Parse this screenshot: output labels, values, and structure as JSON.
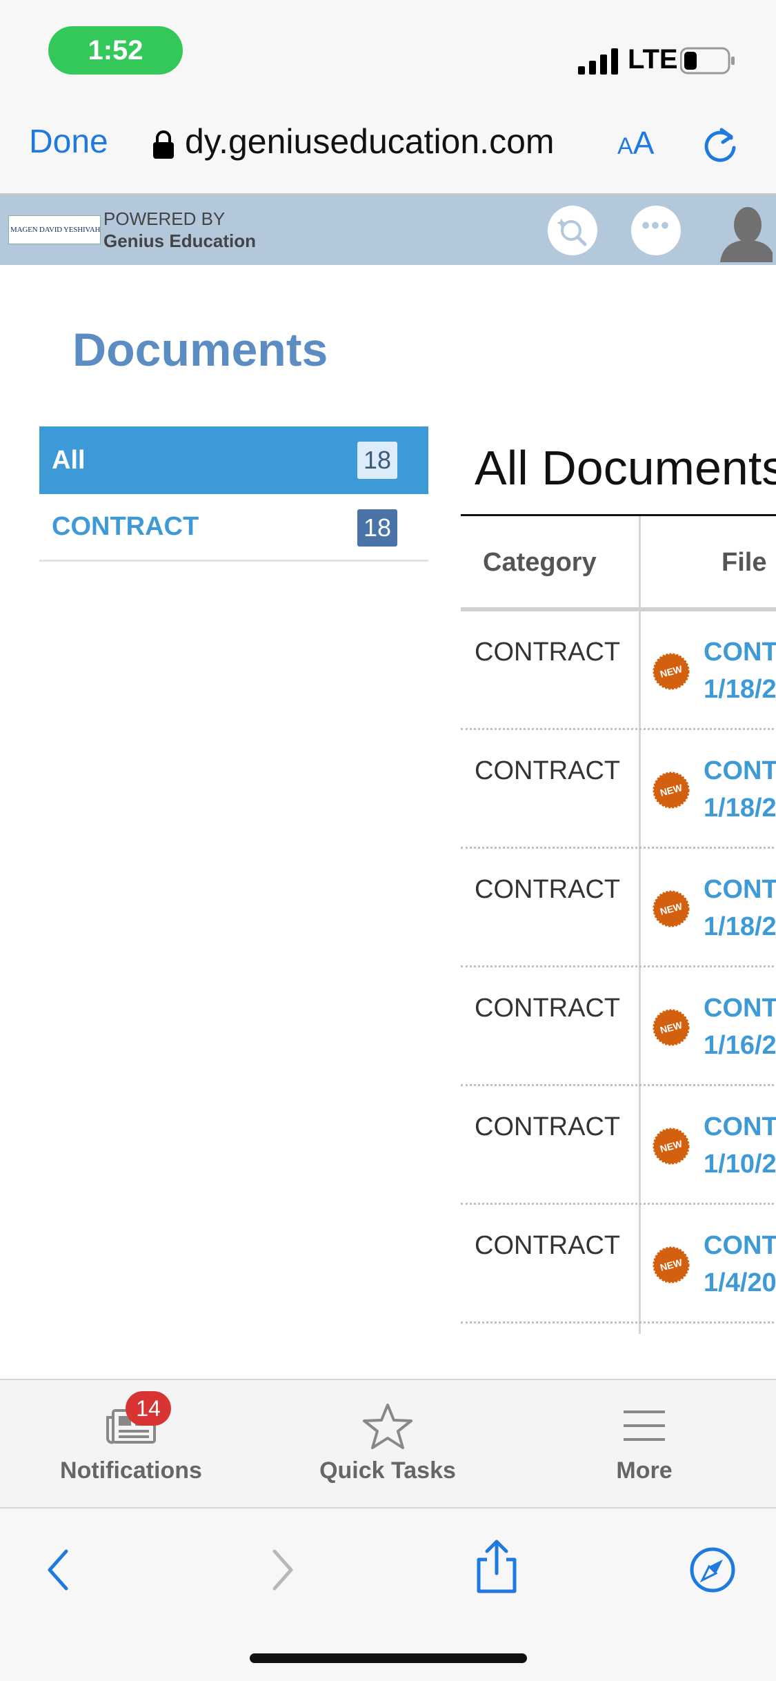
{
  "status_bar": {
    "time": "1:52",
    "network": "LTE"
  },
  "browser": {
    "done_label": "Done",
    "url_text": "dy.geniuseducation.com",
    "text_size_label_small": "A",
    "text_size_label_large": "A"
  },
  "app_header": {
    "school_logo_text": "MAGEN DAVID YESHIVAH",
    "powered_by": "POWERED BY",
    "brand": "Genius Education"
  },
  "page": {
    "title": "Documents"
  },
  "categories": [
    {
      "label": "All",
      "count": "18",
      "active": true
    },
    {
      "label": "CONTRACT",
      "count": "18",
      "active": false
    }
  ],
  "documents": {
    "heading": "All Documents",
    "columns": {
      "category": "Category",
      "file": "File"
    },
    "rows": [
      {
        "category": "CONTRACT",
        "badge": "NEW",
        "file_name": "CONT",
        "file_date": "1/18/2"
      },
      {
        "category": "CONTRACT",
        "badge": "NEW",
        "file_name": "CONT",
        "file_date": "1/18/2"
      },
      {
        "category": "CONTRACT",
        "badge": "NEW",
        "file_name": "CONT",
        "file_date": "1/18/2"
      },
      {
        "category": "CONTRACT",
        "badge": "NEW",
        "file_name": "CONT",
        "file_date": "1/16/2"
      },
      {
        "category": "CONTRACT",
        "badge": "NEW",
        "file_name": "CONT",
        "file_date": "1/10/2"
      },
      {
        "category": "CONTRACT",
        "badge": "NEW",
        "file_name": "CONT",
        "file_date": "1/4/20"
      }
    ]
  },
  "tab_bar": {
    "notifications": {
      "label": "Notifications",
      "badge": "14"
    },
    "quick_tasks": {
      "label": "Quick Tasks"
    },
    "more": {
      "label": "More"
    }
  },
  "colors": {
    "accent": "#3d9ad6",
    "title": "#5b8cc2",
    "header_bg": "#b4c8dc",
    "new_badge": "#d2600e",
    "notification_badge": "#d83434",
    "time_pill": "#34c759",
    "ios_blue": "#1f7ae0"
  },
  "icons": {
    "lock": "lock-icon",
    "reload": "reload-icon",
    "search": "magnify-sparkle-icon",
    "more": "ellipsis-icon",
    "avatar": "user-silhouette-icon",
    "notifications": "newspaper-icon",
    "quick_tasks": "star-icon",
    "more_tab": "hamburger-icon",
    "back": "chevron-left-icon",
    "forward": "chevron-right-icon",
    "share": "share-icon",
    "compass": "compass-icon"
  }
}
